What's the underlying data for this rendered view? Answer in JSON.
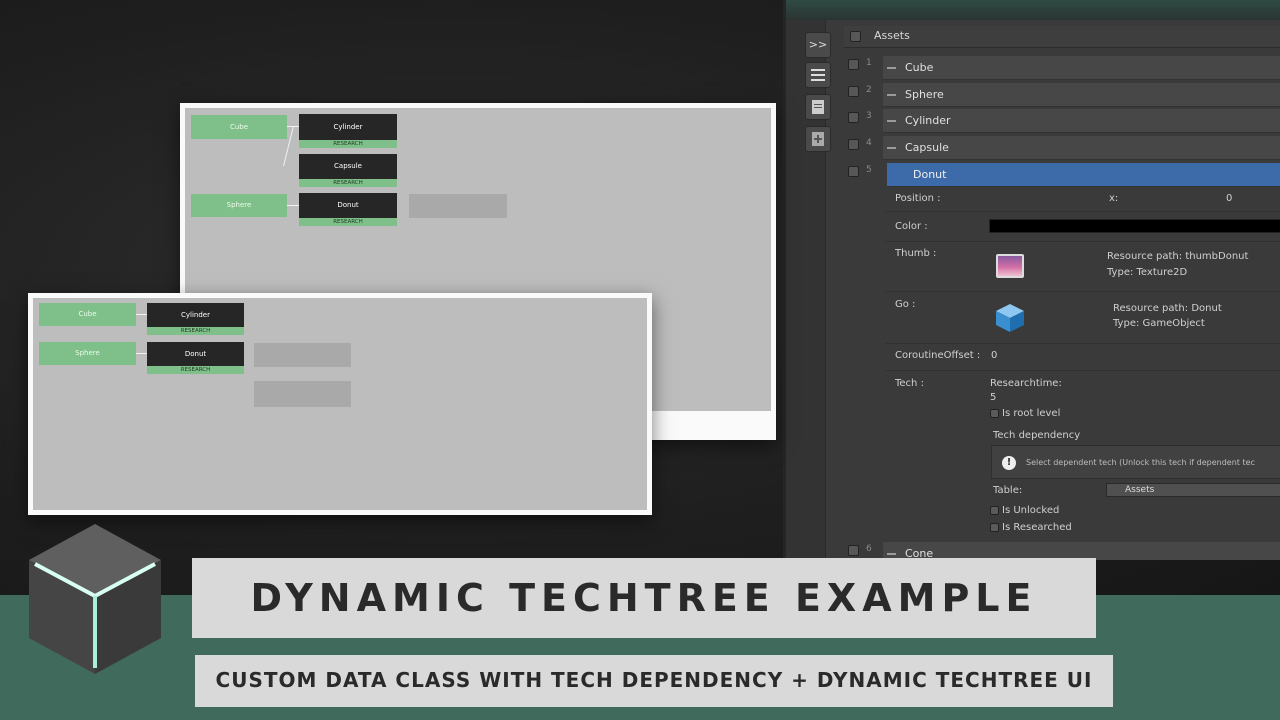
{
  "inspector": {
    "header": "Assets",
    "toolbar": {
      "expand_label": ">>"
    },
    "rows": [
      {
        "index": "1",
        "label": "Cube"
      },
      {
        "index": "2",
        "label": "Sphere"
      },
      {
        "index": "3",
        "label": "Cylinder"
      },
      {
        "index": "4",
        "label": "Capsule"
      },
      {
        "index": "5",
        "label": "Donut"
      }
    ],
    "last_row": {
      "index": "6",
      "label": "Cone"
    },
    "fields": {
      "position_label": "Position :",
      "position_x_label": "x:",
      "position_x_value": "0",
      "color_label": "Color :",
      "thumb_label": "Thumb :",
      "thumb_resource": "Resource path: thumbDonut",
      "thumb_type": "Type: Texture2D",
      "go_label": "Go :",
      "go_resource": "Resource path: Donut",
      "go_type": "Type: GameObject",
      "coroutine_label": "CoroutineOffset :",
      "coroutine_value": "0",
      "tech_label": "Tech :",
      "researchtime_label": "Researchtime:",
      "researchtime_value": "5",
      "root_level_label": "Is root level",
      "tech_dependency_label": "Tech dependency",
      "info_text": "Select dependent tech (Unlock this tech if dependent tec",
      "table_label": "Table:",
      "table_value": "Assets",
      "unlocked_label": "Is Unlocked",
      "researched_label": "Is Researched"
    }
  },
  "techtree_large": {
    "nodes": {
      "cube": "Cube",
      "cylinder": "Cylinder",
      "capsule": "Capsule",
      "sphere": "Sphere",
      "donut": "Donut"
    },
    "tag": "RESEARCH"
  },
  "techtree_small": {
    "nodes": {
      "cube": "Cube",
      "cylinder": "Cylinder",
      "sphere": "Sphere",
      "donut": "Donut"
    },
    "tag": "RESEARCH"
  },
  "title": "DYNAMIC TECHTREE EXAMPLE",
  "subtitle": "CUSTOM DATA CLASS WITH TECH DEPENDENCY + DYNAMIC TECHTREE UI",
  "colors": {
    "selected_row": "#3d6aa8",
    "node_green": "#7fc08a",
    "node_dark": "#262626",
    "band": "#3f6a5c"
  }
}
